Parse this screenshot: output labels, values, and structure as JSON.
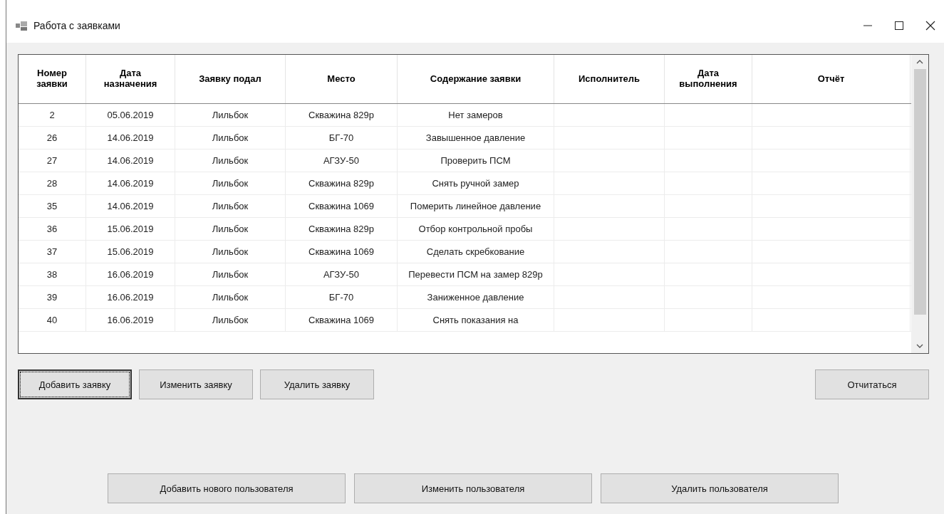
{
  "window": {
    "title": "Работа с заявками"
  },
  "table": {
    "columns": [
      "Номер заявки",
      "Дата назначения",
      "Заявку подал",
      "Место",
      "Содержание заявки",
      "Исполнитель",
      "Дата выполнения",
      "Отчёт"
    ],
    "rows": [
      [
        "2",
        "05.06.2019",
        "Лильбок",
        "Скважина 829р",
        "Нет замеров"
      ],
      [
        "26",
        "14.06.2019",
        "Лильбок",
        "БГ-70",
        "Завышенное давление"
      ],
      [
        "27",
        "14.06.2019",
        "Лильбок",
        "АГЗУ-50",
        "Проверить ПСМ"
      ],
      [
        "28",
        "14.06.2019",
        "Лильбок",
        "Скважина 829р",
        "Снять ручной замер"
      ],
      [
        "35",
        "14.06.2019",
        "Лильбок",
        "Скважина 1069",
        "Померить линейное давление"
      ],
      [
        "36",
        "15.06.2019",
        "Лильбок",
        "Скважина 829р",
        "Отбор контрольной пробы"
      ],
      [
        "37",
        "15.06.2019",
        "Лильбок",
        "Скважина 1069",
        "Сделать скребкование"
      ],
      [
        "38",
        "16.06.2019",
        "Лильбок",
        "АГЗУ-50",
        "Перевести ПСМ на замер 829р"
      ],
      [
        "39",
        "16.06.2019",
        "Лильбок",
        "БГ-70",
        "Заниженное давление"
      ],
      [
        "40",
        "16.06.2019",
        "Лильбок",
        "Скважина 1069",
        "Снять показания на"
      ]
    ]
  },
  "request_buttons": [
    {
      "label": "Добавить заявку",
      "focused": true
    },
    {
      "label": "Изменить заявку",
      "focused": false
    },
    {
      "label": "Удалить заявку",
      "focused": false
    }
  ],
  "report_button": {
    "label": "Отчитаться"
  },
  "user_buttons": [
    {
      "label": "Добавить нового пользователя",
      "focused": false
    },
    {
      "label": "Изменить пользователя",
      "focused": false
    },
    {
      "label": "Удалить пользователя",
      "focused": false
    }
  ]
}
